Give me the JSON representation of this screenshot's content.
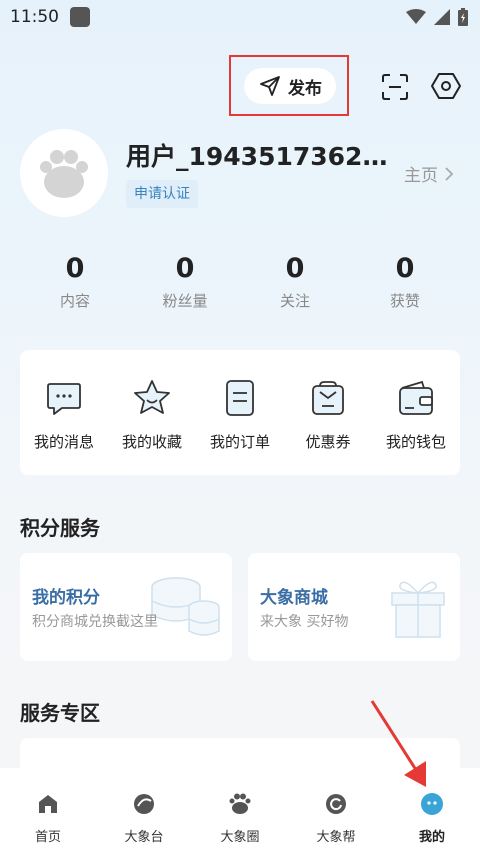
{
  "status_bar": {
    "time": "11:50"
  },
  "header": {
    "publish_label": "发布"
  },
  "profile": {
    "username": "用户_1943517362…",
    "verify_label": "申请认证",
    "homepage_label": "主页"
  },
  "stats": [
    {
      "value": "0",
      "label": "内容"
    },
    {
      "value": "0",
      "label": "粉丝量"
    },
    {
      "value": "0",
      "label": "关注"
    },
    {
      "value": "0",
      "label": "获赞"
    }
  ],
  "quick_actions": [
    {
      "label": "我的消息",
      "icon": "message-icon"
    },
    {
      "label": "我的收藏",
      "icon": "star-icon"
    },
    {
      "label": "我的订单",
      "icon": "order-icon"
    },
    {
      "label": "优惠券",
      "icon": "coupon-icon"
    },
    {
      "label": "我的钱包",
      "icon": "wallet-icon"
    }
  ],
  "points_section": {
    "title": "积分服务",
    "cards": [
      {
        "title": "我的积分",
        "subtitle": "积分商城兑换截这里",
        "icon": "coins-icon"
      },
      {
        "title": "大象商城",
        "subtitle": "来大象  买好物",
        "icon": "gift-icon"
      }
    ]
  },
  "service_section": {
    "title": "服务专区"
  },
  "tabbar": {
    "items": [
      {
        "label": "首页",
        "icon": "home-icon"
      },
      {
        "label": "大象台",
        "icon": "elephant-tv-icon"
      },
      {
        "label": "大象圈",
        "icon": "paw-icon"
      },
      {
        "label": "大象帮",
        "icon": "help-icon"
      },
      {
        "label": "我的",
        "icon": "profile-icon",
        "active": true
      }
    ]
  },
  "colors": {
    "accent": "#3a83c0",
    "highlight": "#e53935",
    "active_tab": "#3aa3d8"
  }
}
